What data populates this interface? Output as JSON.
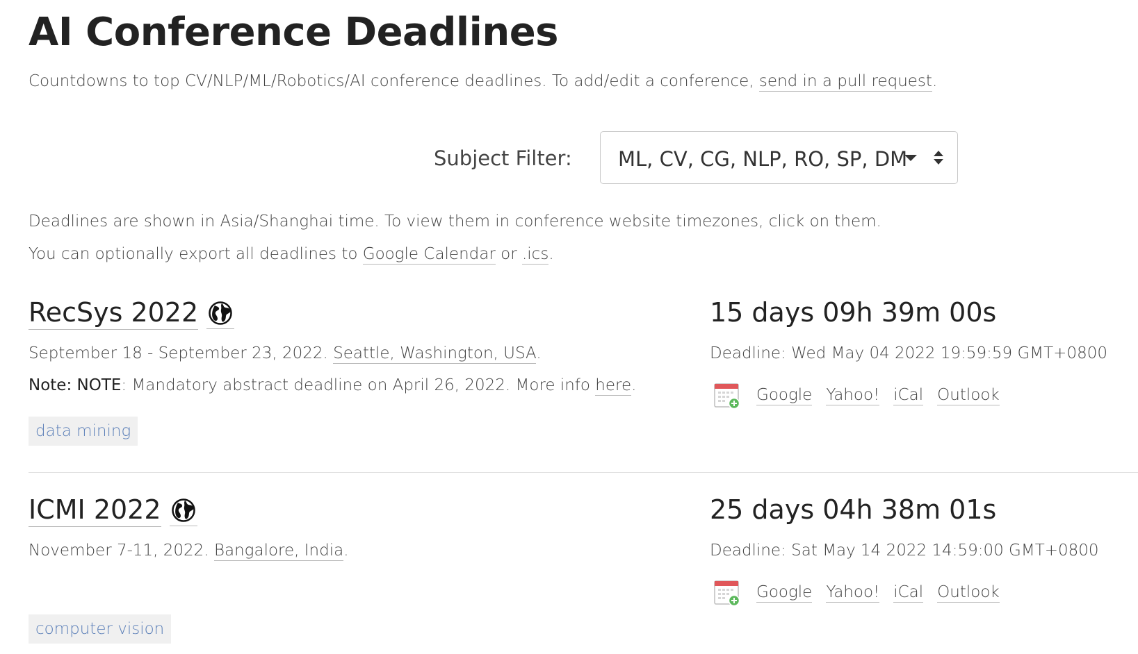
{
  "header": {
    "title": "AI Conference Deadlines",
    "intro_text": "Countdowns to top CV/NLP/ML/Robotics/AI conference deadlines. To add/edit a conference, ",
    "intro_link": "send in a pull request",
    "intro_end": "."
  },
  "filter": {
    "label": "Subject Filter:",
    "selected": "ML, CV, CG, NLP, RO, SP, DM"
  },
  "notes": {
    "timezone_text": "Deadlines are shown in Asia/Shanghai time. To view them in conference website timezones, click on them.",
    "export_prefix": "You can optionally export all deadlines to ",
    "export_google": "Google Calendar",
    "export_or": " or ",
    "export_ics": ".ics",
    "export_end": "."
  },
  "conferences": [
    {
      "name": "RecSys 2022",
      "dates": "September 18 - September 23, 2022. ",
      "location": "Seattle, Washington, USA",
      "location_end": ".",
      "note_label": "Note: NOTE",
      "note_text": ": Mandatory abstract deadline on April 26, 2022. More info ",
      "note_link": "here",
      "note_end": ".",
      "tag": "data mining",
      "countdown": "15 days 09h 39m 00s",
      "deadline": "Deadline: Wed May 04 2022 19:59:59 GMT+0800"
    },
    {
      "name": "ICMI 2022",
      "dates": "November 7-11, 2022. ",
      "location": "Bangalore, India",
      "location_end": ".",
      "tag": "computer vision",
      "countdown": "25 days 04h 38m 01s",
      "deadline": "Deadline: Sat May 14 2022 14:59:00 GMT+0800"
    }
  ],
  "calendar_links": {
    "google": "Google",
    "yahoo": "Yahoo!",
    "ical": "iCal",
    "outlook": "Outlook"
  },
  "icons": {
    "globe": "globe-icon",
    "calendar_add": "calendar-add-icon"
  },
  "colors": {
    "tag_text": "#5b7fb8",
    "tag_bg": "#f0f0f0",
    "calendar_red": "#e0575a",
    "calendar_plus": "#5cb85c"
  }
}
